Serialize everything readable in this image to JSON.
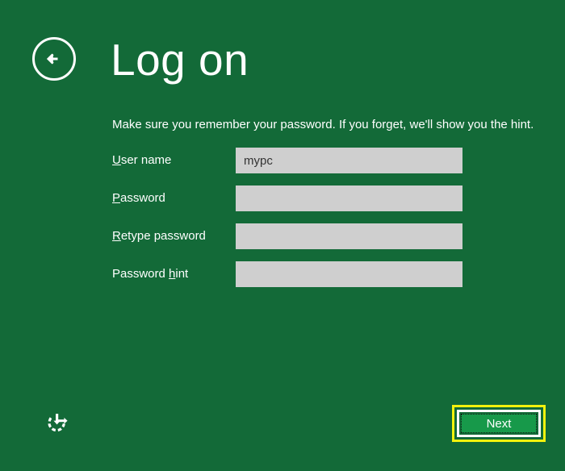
{
  "theme": {
    "background_color": "#136A38",
    "accent_color": "#17994A",
    "focus_highlight_color": "#F2F20D",
    "field_color": "#CFCFCF",
    "text_color": "#FFFFFF"
  },
  "header": {
    "back_icon": "back-arrow-icon",
    "title": "Log on"
  },
  "main": {
    "description": "Make sure you remember your password. If you forget, we'll show you the hint.",
    "fields": [
      {
        "label_prefix": "",
        "label_accesskey": "U",
        "label_suffix": "ser name",
        "label_full": "User name",
        "value": "mypc",
        "placeholder": "",
        "type": "text",
        "name": "user-name"
      },
      {
        "label_prefix": "",
        "label_accesskey": "P",
        "label_suffix": "assword",
        "label_full": "Password",
        "value": "",
        "placeholder": "",
        "type": "password",
        "name": "password"
      },
      {
        "label_prefix": "",
        "label_accesskey": "R",
        "label_suffix": "etype password",
        "label_full": "Retype password",
        "value": "",
        "placeholder": "",
        "type": "password",
        "name": "retype-password"
      },
      {
        "label_prefix": "Password ",
        "label_accesskey": "h",
        "label_suffix": "int",
        "label_full": "Password hint",
        "value": "",
        "placeholder": "",
        "type": "text",
        "name": "password-hint"
      }
    ]
  },
  "footer": {
    "ease_of_access_icon": "ease-of-access-icon",
    "next_label": "Next"
  }
}
